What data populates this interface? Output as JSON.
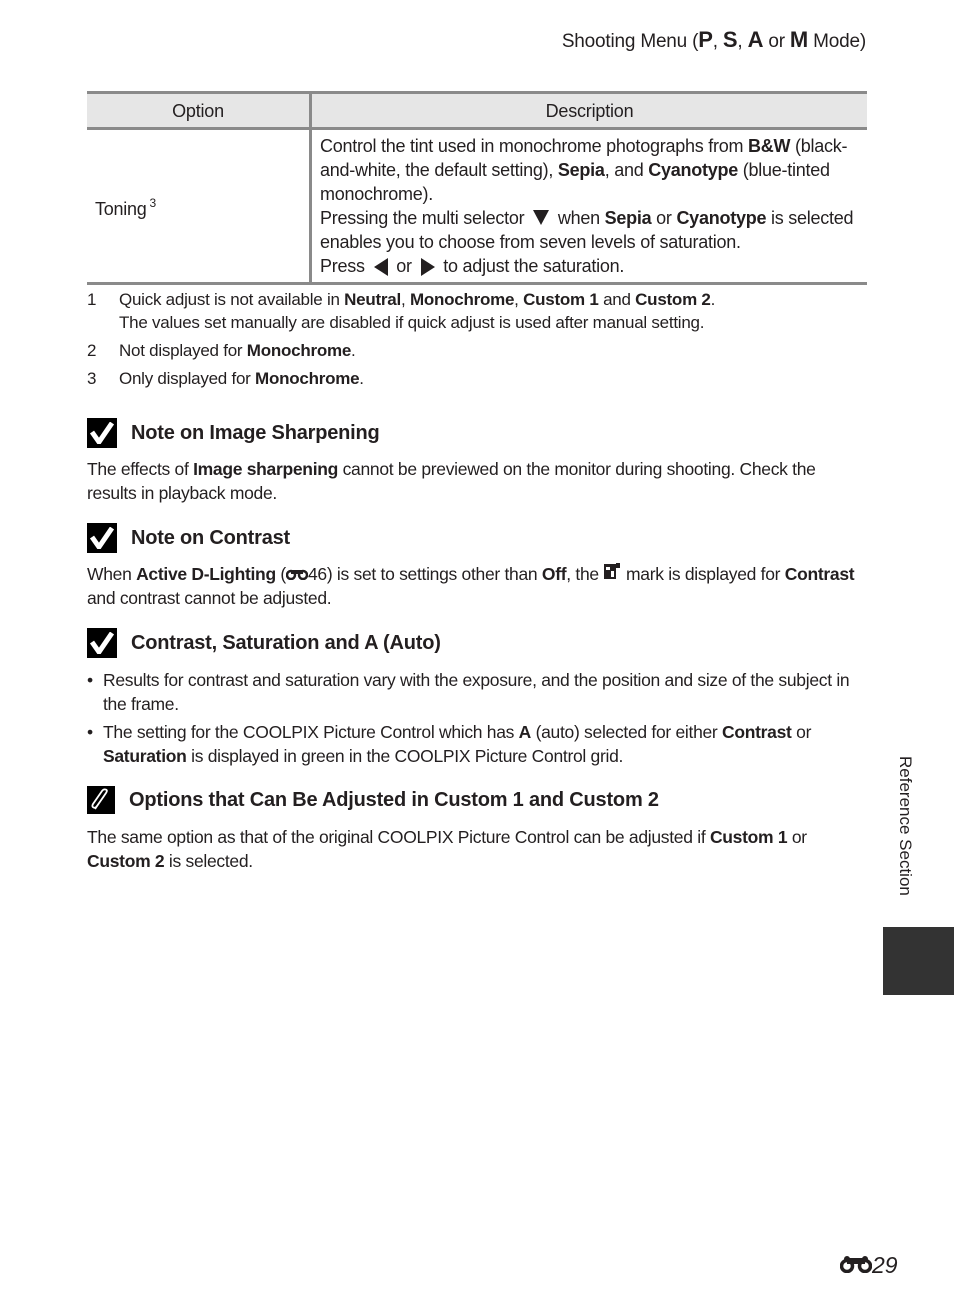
{
  "header": {
    "title_prefix": "Shooting Menu (",
    "mode_p": "P",
    "sep1": ", ",
    "mode_s": "S",
    "sep2": ", ",
    "mode_a": "A",
    "or": " or ",
    "mode_m": "M",
    "title_suffix": " Mode)"
  },
  "table": {
    "headers": [
      "Option",
      "Description"
    ],
    "rows": [
      {
        "option": "Toning",
        "option_sup": "3",
        "desc": {
          "p1_a": "Control the tint used in monochrome photographs from ",
          "p1_b": "B&W",
          "p1_c": " (black-and-white, the default setting), ",
          "p1_d": "Sepia",
          "p1_e": ", and ",
          "p1_f": "Cyanotype",
          "p1_g": " (blue-tinted monochrome).",
          "p2_a": "Pressing the multi selector ",
          "p2_b": " when ",
          "p2_c": "Sepia",
          "p2_d": " or ",
          "p2_e": "Cyanotype",
          "p2_f": " is selected enables you to choose from seven levels of saturation.",
          "p3_a": "Press ",
          "p3_b": " or ",
          "p3_c": " to adjust the saturation."
        }
      }
    ]
  },
  "footnotes": [
    {
      "num": "1",
      "a": "Quick adjust is not available in ",
      "b": "Neutral",
      "c": ", ",
      "d": "Monochrome",
      "e": ", ",
      "f": "Custom 1",
      "g": " and ",
      "h": "Custom 2",
      "i": ".",
      "line2": "The values set manually are disabled if quick adjust is used after manual setting."
    },
    {
      "num": "2",
      "a": "Not displayed for ",
      "b": "Monochrome",
      "c": "."
    },
    {
      "num": "3",
      "a": "Only displayed for ",
      "b": "Monochrome",
      "c": "."
    }
  ],
  "sections": [
    {
      "icon": "check-icon",
      "title": "Note on Image Sharpening",
      "body": {
        "a": "The effects of ",
        "b": "Image sharpening",
        "c": " cannot be previewed on the monitor during shooting. Check the results in playback mode."
      }
    },
    {
      "icon": "check-icon",
      "title": "Note on Contrast",
      "body": {
        "a": "When ",
        "b": "Active D-Lighting",
        "c": " (",
        "ref": "46",
        "d": ") is set to settings other than ",
        "e": "Off",
        "f": ", the ",
        "g": " mark is displayed for ",
        "h": "Contrast",
        "i": " and contrast cannot be adjusted."
      }
    },
    {
      "icon": "check-icon",
      "title": "Contrast, Saturation and A (Auto)",
      "bullets": [
        {
          "a": "Results for contrast and saturation vary with the exposure, and the position and size of the subject in the frame."
        },
        {
          "a": "The setting for the COOLPIX Picture Control which has ",
          "b": "A",
          "c": " (auto) selected for either ",
          "d": "Contrast",
          "e": " or ",
          "f": "Saturation",
          "g": " is displayed in green in the COOLPIX Picture Control grid."
        }
      ]
    },
    {
      "icon": "paperclip-icon",
      "title": "Options that Can Be Adjusted in Custom 1 and Custom 2",
      "body": {
        "a": "The same option as that of the original COOLPIX Picture Control can be adjusted if ",
        "b": "Custom 1",
        "c": " or ",
        "d": "Custom 2",
        "e": " is selected."
      }
    }
  ],
  "side": {
    "label": "Reference Section",
    "tab_color": "#333333"
  },
  "page": {
    "number": "29",
    "icon": "binoculars-icon"
  },
  "colors": {
    "text": "#231f20",
    "table_header_bg": "#e6e6e6",
    "rule": "#8a8a8a"
  },
  "bullet_char": "•"
}
